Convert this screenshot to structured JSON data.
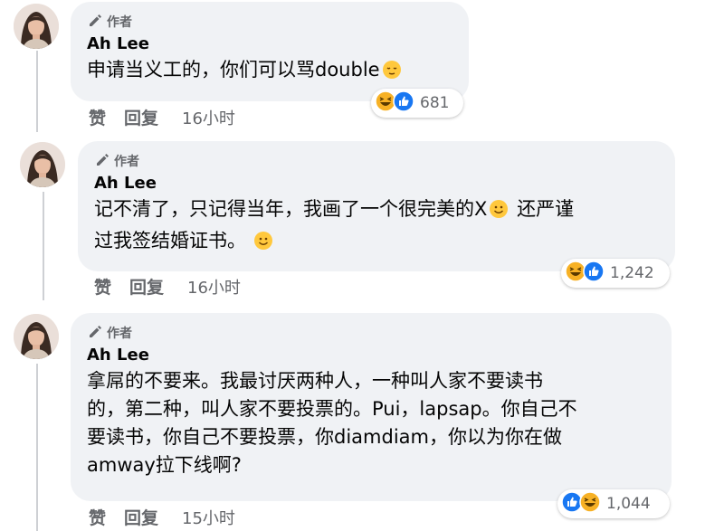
{
  "comments": [
    {
      "badge": "作者",
      "author": "Ah Lee",
      "text_lines": [
        "申请当义工的，你们可以骂double"
      ],
      "reaction_count": "681",
      "like_label": "赞",
      "reply_label": "回复",
      "time": "16小时"
    },
    {
      "badge": "作者",
      "author": "Ah Lee",
      "text_lines": [
        "记不清了，只记得当年，我画了一个很完美的X",
        " 还严谨",
        "过我签结婚证书。"
      ],
      "reaction_count": "1,242",
      "like_label": "赞",
      "reply_label": "回复",
      "time": "16小时"
    },
    {
      "badge": "作者",
      "author": "Ah Lee",
      "text_lines": [
        "拿屌的不要来。我最讨厌两种人，一种叫人家不要读书",
        "的，第二种，叫人家不要投票的。Pui，lapsap。你自己不",
        "要读书，你自己不要投票，你diamdiam，你以为你在做",
        "amway拉下线啊?"
      ],
      "reaction_count": "1,044",
      "like_label": "赞",
      "reply_label": "回复",
      "time": "15小时"
    }
  ],
  "colors": {
    "bubble": "#f0f2f5",
    "secondary_text": "#65676b",
    "like_blue": "#1877f2",
    "haha_yellow": "#f7b125"
  },
  "icons": [
    "pencil-icon",
    "haha-reaction-icon",
    "like-reaction-icon",
    "relieved-emoji",
    "smile-emoji"
  ]
}
